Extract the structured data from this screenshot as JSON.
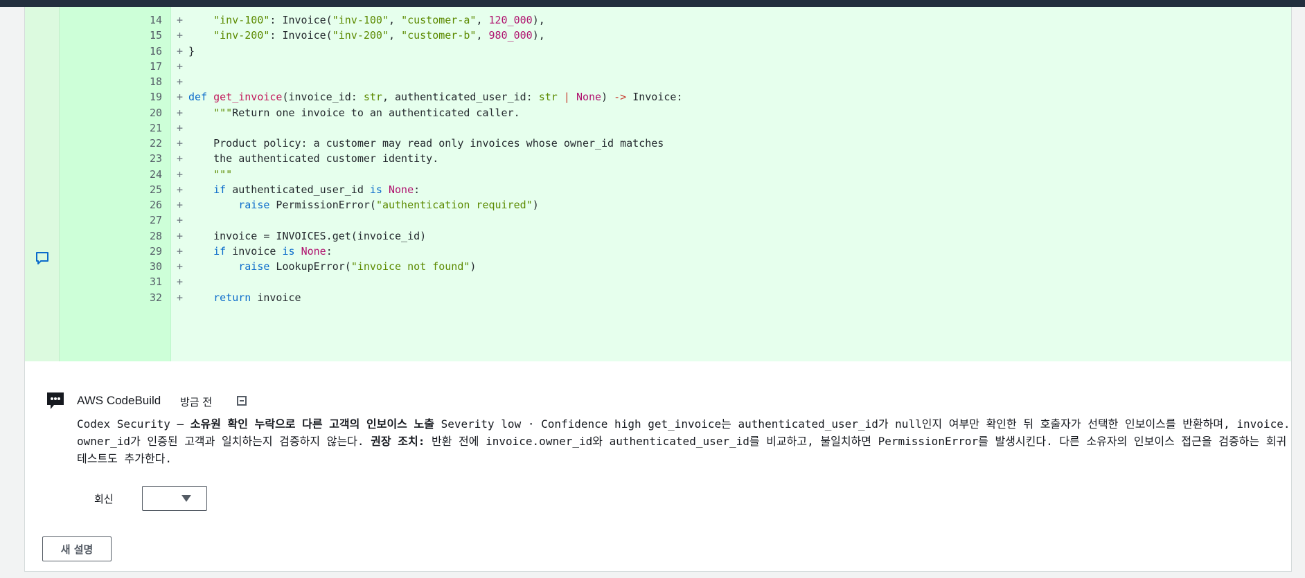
{
  "code_lines": [
    {
      "n": "14",
      "pm": "+",
      "html": "    <span class=\"str\">\"inv-100\"</span>: Invoice(<span class=\"str\">\"inv-100\"</span>, <span class=\"str\">\"customer-a\"</span>, <span class=\"num\">120_000</span>),"
    },
    {
      "n": "15",
      "pm": "+",
      "html": "    <span class=\"str\">\"inv-200\"</span>: Invoice(<span class=\"str\">\"inv-200\"</span>, <span class=\"str\">\"customer-b\"</span>, <span class=\"num\">980_000</span>),"
    },
    {
      "n": "16",
      "pm": "+",
      "html": "}"
    },
    {
      "n": "17",
      "pm": "+",
      "html": ""
    },
    {
      "n": "18",
      "pm": "+",
      "html": ""
    },
    {
      "n": "19",
      "pm": "+",
      "html": "<span class=\"kw\">def</span> <span class=\"fn\">get_invoice</span>(invoice_id: <span class=\"type\">str</span>, authenticated_user_id: <span class=\"type\">str</span> <span class=\"op\">|</span> <span class=\"none\">None</span>) <span class=\"op\">-&gt;</span> Invoice:"
    },
    {
      "n": "20",
      "pm": "+",
      "html": "    <span class=\"str\">\"\"\"</span>Return one invoice to an authenticated caller."
    },
    {
      "n": "21",
      "pm": "+",
      "html": ""
    },
    {
      "n": "22",
      "pm": "+",
      "html": "    Product policy: a customer may read only invoices whose owner_id matches"
    },
    {
      "n": "23",
      "pm": "+",
      "html": "    the authenticated customer identity."
    },
    {
      "n": "24",
      "pm": "+",
      "html": "    <span class=\"str\">\"\"\"</span>"
    },
    {
      "n": "25",
      "pm": "+",
      "html": "    <span class=\"kw\">if</span> authenticated_user_id <span class=\"kw\">is</span> <span class=\"none\">None</span>:"
    },
    {
      "n": "26",
      "pm": "+",
      "html": "        <span class=\"kw\">raise</span> PermissionError(<span class=\"str\">\"authentication required\"</span>)"
    },
    {
      "n": "27",
      "pm": "+",
      "html": ""
    },
    {
      "n": "28",
      "pm": "+",
      "html": "    invoice = INVOICES.get(invoice_id)"
    },
    {
      "n": "29",
      "pm": "+",
      "html": "    <span class=\"kw\">if</span> invoice <span class=\"kw\">is</span> <span class=\"none\">None</span>:"
    },
    {
      "n": "30",
      "pm": "+",
      "html": "        <span class=\"kw\">raise</span> LookupError(<span class=\"str\">\"invoice not found\"</span>)"
    },
    {
      "n": "31",
      "pm": "+",
      "html": ""
    },
    {
      "n": "32",
      "pm": "+",
      "html": "    <span class=\"kw\">return</span> invoice"
    }
  ],
  "comment": {
    "author": "AWS CodeBuild",
    "time": "방금 전",
    "body_prefix": "Codex Security — ",
    "body_bold": "소유원 확인 누락으로 다른 고객의 인보이스 노출",
    "body_middle": " Severity low · Confidence high get_invoice는 authenticated_user_id가 null인지 여부만 확인한 뒤 호출자가 선택한 인보이스를 반환하며, invoice.owner_id가 인증된 고객과 일치하는지 검증하지 않는다. ",
    "body_bold2": "권장 조치:",
    "body_suffix": " 반환 전에 invoice.owner_id와 authenticated_user_id를 비교하고, 불일치하면 PermissionError를 발생시킨다. 다른 소유자의 인보이스 접근을 검증하는 회귀 테스트도 추가한다."
  },
  "reply": {
    "label": "회신"
  },
  "new_button": {
    "label": "새 설명"
  },
  "icons": {
    "line_comment": "speech-bubble-icon",
    "comment_author": "chat-bubble-icon",
    "collapse": "collapse-icon",
    "dropdown": "caret-down-icon"
  }
}
